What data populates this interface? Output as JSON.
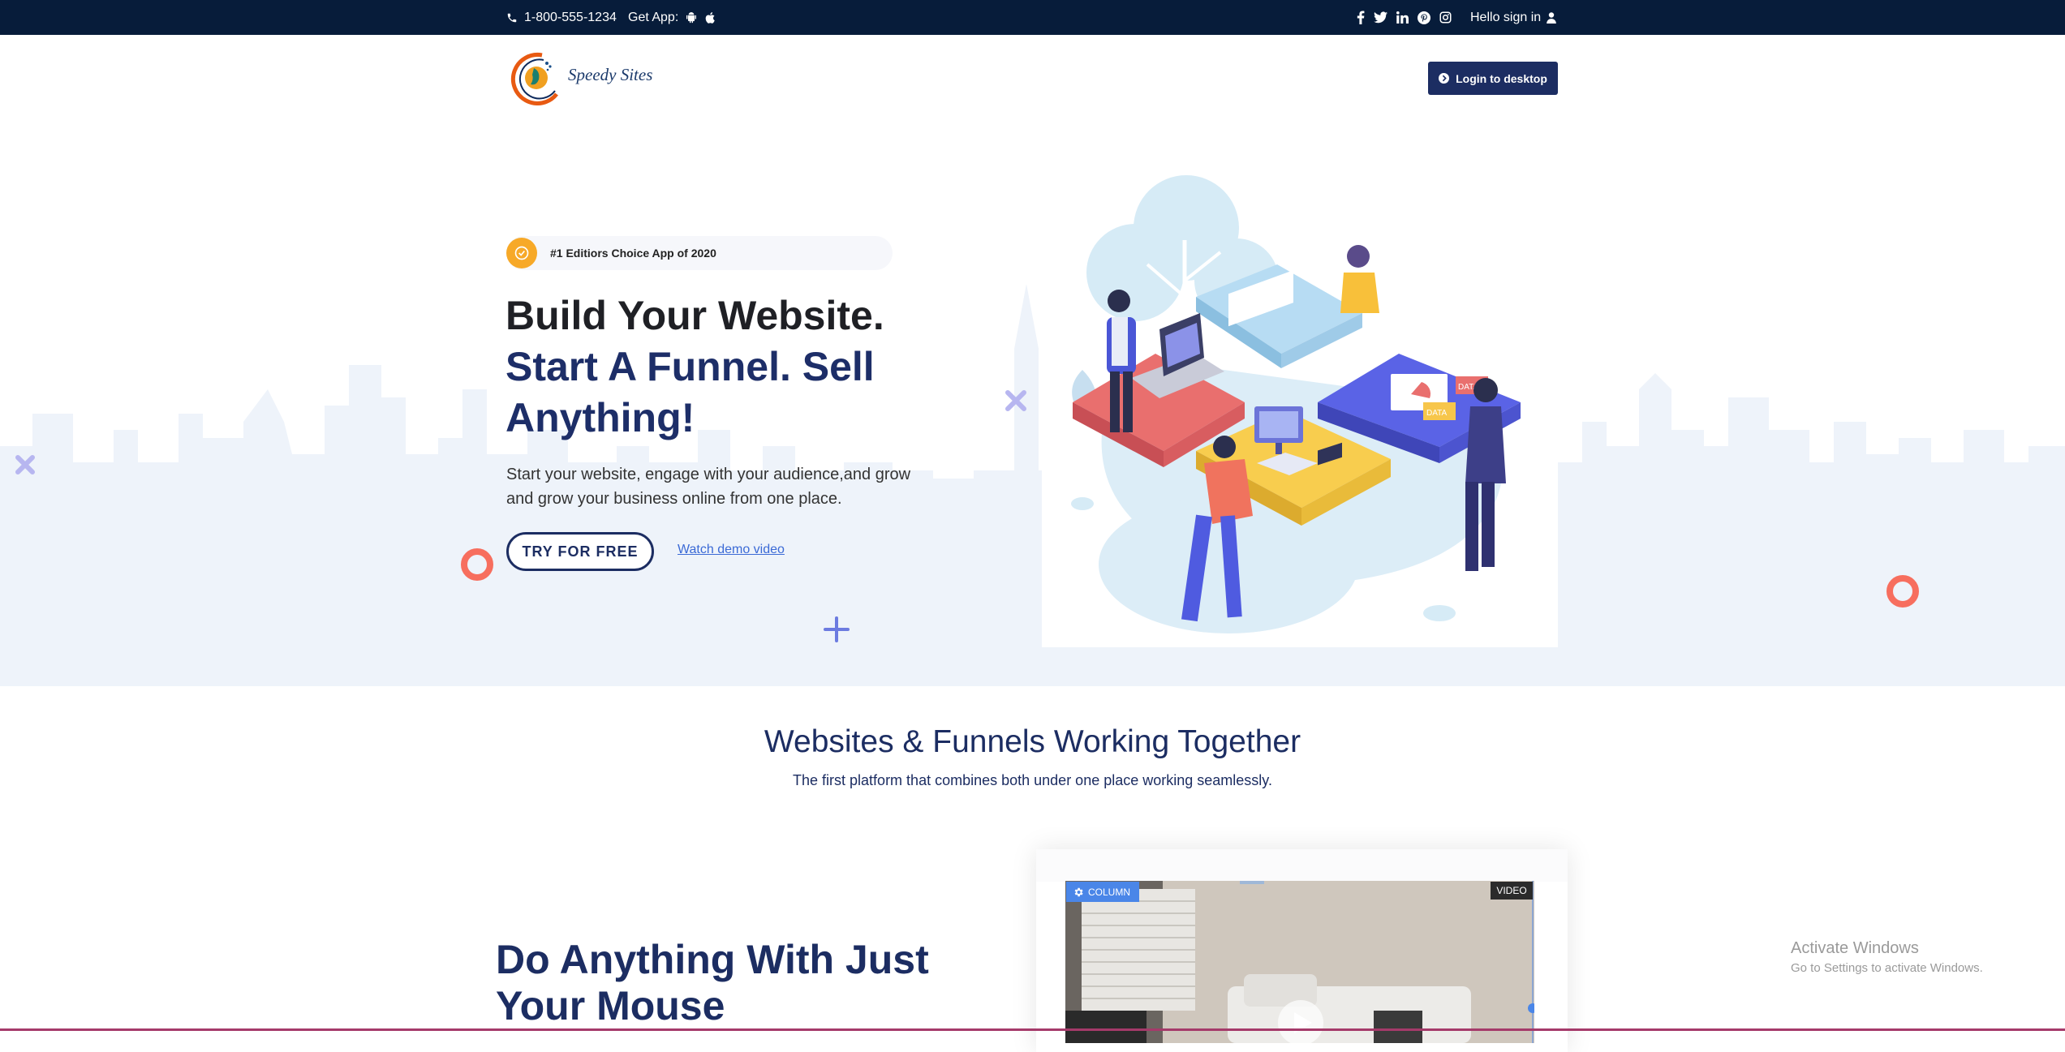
{
  "topbar": {
    "phone": "1-800-555-1234",
    "get_app": "Get App:",
    "app_icons": [
      "android-icon",
      "apple-icon"
    ],
    "social_icons": [
      "facebook-icon",
      "twitter-icon",
      "linkedin-icon",
      "pinterest-icon",
      "instagram-icon"
    ],
    "signin": "Hello sign in",
    "background": "#071c3a"
  },
  "header": {
    "logo_text": "Speedy Sites",
    "login_button": "Login to desktop"
  },
  "hero": {
    "badge": "#1 Editiors Choice App of 2020",
    "title_line1": "Build Your Website.",
    "title_line2": "Start A Funnel. Sell Anything!",
    "lead": "Start your website, engage with your audience,and grow and grow your business online from one place.",
    "try_button": "TRY FOR FREE",
    "demo_link": "Watch demo video",
    "illustration_labels": [
      "DATA",
      "DATA"
    ]
  },
  "section": {
    "title": "Websites & Funnels Working Together",
    "subtitle": "The first platform that combines both under one place working seamlessly."
  },
  "feature": {
    "title": "Do Anything With Just Your Mouse",
    "column_tag": "COLUMN",
    "video_tag": "VIDEO"
  },
  "os_overlay": {
    "line1": "Activate Windows",
    "line2": "Go to Settings to activate Windows."
  },
  "colors": {
    "navy": "#1c2d62",
    "accent": "#f7a928",
    "skyline": "#eef3fa"
  }
}
